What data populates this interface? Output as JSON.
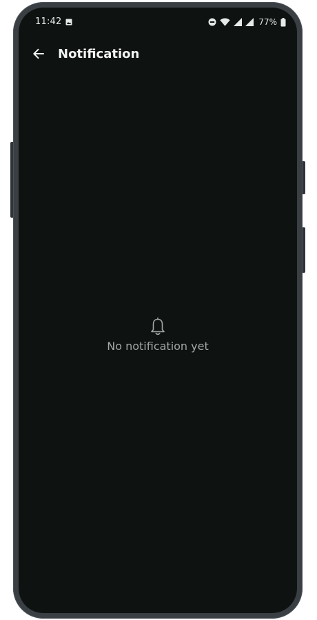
{
  "status_bar": {
    "time": "11:42",
    "battery": "77%",
    "icons": [
      "gallery-icon",
      "dnd-icon",
      "wifi-icon",
      "signal-icon",
      "signal-icon",
      "battery-icon"
    ]
  },
  "app_bar": {
    "back_icon": "arrow-left-icon",
    "title": "Notification"
  },
  "empty_state": {
    "icon": "bell-icon",
    "message": "No notification yet"
  },
  "colors": {
    "screen_background": "#0e1211",
    "device_frame": "#3a3f44",
    "title_text": "#f2f4f4",
    "muted_text": "#a3a8a8"
  }
}
